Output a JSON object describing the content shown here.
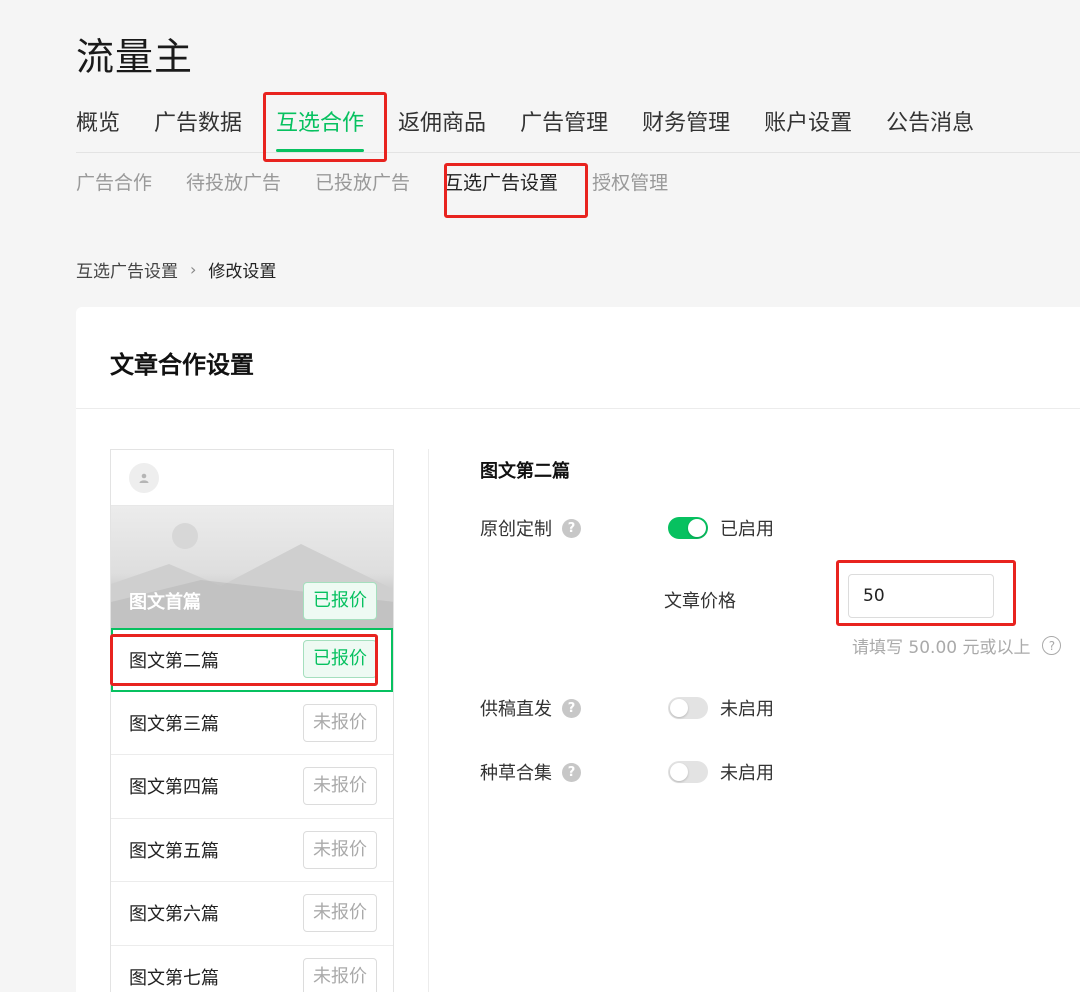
{
  "app": {
    "title": "流量主"
  },
  "main_nav": [
    {
      "label": "概览",
      "active": false
    },
    {
      "label": "广告数据",
      "active": false
    },
    {
      "label": "互选合作",
      "active": true
    },
    {
      "label": "返佣商品",
      "active": false
    },
    {
      "label": "广告管理",
      "active": false
    },
    {
      "label": "财务管理",
      "active": false
    },
    {
      "label": "账户设置",
      "active": false
    },
    {
      "label": "公告消息",
      "active": false
    }
  ],
  "sub_nav": [
    {
      "label": "广告合作",
      "active": false
    },
    {
      "label": "待投放广告",
      "active": false
    },
    {
      "label": "已投放广告",
      "active": false
    },
    {
      "label": "互选广告设置",
      "active": true
    },
    {
      "label": "授权管理",
      "active": false
    }
  ],
  "breadcrumb": {
    "parent": "互选广告设置",
    "separator": "›",
    "current": "修改设置"
  },
  "card": {
    "title": "文章合作设置"
  },
  "preview": {
    "cover": {
      "title": "图文首篇",
      "tag": "已报价",
      "quoted": true
    },
    "articles": [
      {
        "title": "图文第二篇",
        "tag": "已报价",
        "quoted": true,
        "selected": true
      },
      {
        "title": "图文第三篇",
        "tag": "未报价",
        "quoted": false,
        "selected": false
      },
      {
        "title": "图文第四篇",
        "tag": "未报价",
        "quoted": false,
        "selected": false
      },
      {
        "title": "图文第五篇",
        "tag": "未报价",
        "quoted": false,
        "selected": false
      },
      {
        "title": "图文第六篇",
        "tag": "未报价",
        "quoted": false,
        "selected": false
      },
      {
        "title": "图文第七篇",
        "tag": "未报价",
        "quoted": false,
        "selected": false
      }
    ]
  },
  "form": {
    "title": "图文第二篇",
    "original": {
      "label": "原创定制",
      "help": "?",
      "enabled": true,
      "status": "已启用"
    },
    "price": {
      "label": "文章价格",
      "value": "50",
      "hint": "请填写 50.00 元或以上",
      "hint_icon": "?"
    },
    "manuscript": {
      "label": "供稿直发",
      "help": "?",
      "enabled": false,
      "status": "未启用"
    },
    "grass": {
      "label": "种草合集",
      "help": "?",
      "enabled": false,
      "status": "未启用"
    }
  },
  "colors": {
    "accent": "#07c160",
    "annotation": "#e8231f"
  }
}
